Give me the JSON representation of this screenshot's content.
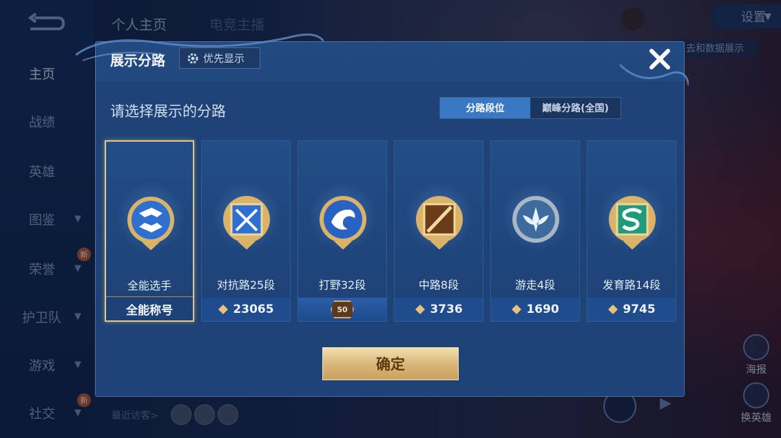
{
  "nav": {
    "items": [
      {
        "label": "主页",
        "active": true,
        "chevron": false
      },
      {
        "label": "战绩",
        "active": false,
        "chevron": false
      },
      {
        "label": "英雄",
        "active": false,
        "chevron": false
      },
      {
        "label": "图鉴",
        "active": false,
        "chevron": true
      },
      {
        "label": "荣誉",
        "active": false,
        "chevron": true,
        "badge": "新"
      },
      {
        "label": "护卫队",
        "active": false,
        "chevron": true
      },
      {
        "label": "游戏",
        "active": false,
        "chevron": true
      },
      {
        "label": "社交",
        "active": false,
        "chevron": true,
        "badge": "新"
      }
    ]
  },
  "header": {
    "tabs": [
      "个人主页",
      "电竞主播"
    ],
    "settings_label": "设置",
    "data_display": "去和数据展示"
  },
  "footer": {
    "recent_visitors": "最近访客>",
    "poster_label": "海报",
    "switch_hero_label": "换英雄"
  },
  "dialog": {
    "title": "展示分路",
    "priority_label": "优先显示",
    "subtitle": "请选择展示的分路",
    "segment": {
      "active": "分路段位",
      "inactive": "巅峰分路(全国)"
    },
    "confirm_label": "确定",
    "cards": [
      {
        "name": "全能选手",
        "footer": "全能称号",
        "selected": true,
        "emblem": "all-round-icon"
      },
      {
        "name": "对抗路25段",
        "footer": "23065",
        "selected": false,
        "emblem": "clash-lane-icon"
      },
      {
        "name": "打野32段",
        "footer": "50",
        "selected": false,
        "emblem": "jungle-icon",
        "footer_type": "medal"
      },
      {
        "name": "中路8段",
        "footer": "3736",
        "selected": false,
        "emblem": "mid-lane-icon"
      },
      {
        "name": "游走4段",
        "footer": "1690",
        "selected": false,
        "emblem": "roam-icon"
      },
      {
        "name": "发育路14段",
        "footer": "9745",
        "selected": false,
        "emblem": "farm-lane-icon"
      }
    ]
  },
  "colors": {
    "accent_blue": "#3a78c4",
    "gold": "#d9b87a",
    "panel": "#1f4376"
  }
}
